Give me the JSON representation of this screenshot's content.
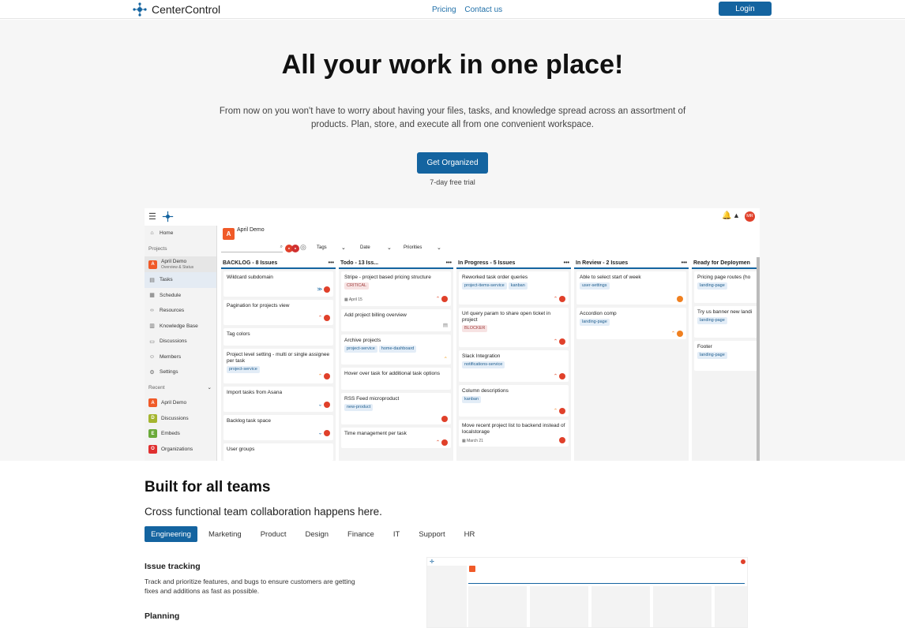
{
  "nav": {
    "brand": "CenterControl",
    "links": [
      "Pricing",
      "Contact us"
    ],
    "login": "Login"
  },
  "hero": {
    "title": "All your work in one place!",
    "subtitle": "From now on you won't have to worry about having your files, tasks, and knowledge spread across an assortment of products. Plan, store, and execute all from one convenient workspace.",
    "cta": "Get Organized",
    "trial": "7-day free trial"
  },
  "app": {
    "project": "April Demo",
    "project_avatar": "A",
    "user_initials": "MR",
    "filters": [
      "Tags",
      "Date",
      "Priorities"
    ],
    "sidebar": {
      "home": "Home",
      "projects_label": "Projects",
      "project_name": "April Demo",
      "project_sub": "Overview & Status",
      "items": [
        "Tasks",
        "Schedule",
        "Resources",
        "Knowledge Base",
        "Discussions",
        "Members",
        "Settings"
      ],
      "recent_label": "Recent",
      "recent": [
        {
          "letter": "A",
          "name": "April Demo",
          "color": "#f05a28"
        },
        {
          "letter": "D",
          "name": "Discussions",
          "color": "#a5b52f"
        },
        {
          "letter": "E",
          "name": "Embeds",
          "color": "#6aaa3a"
        },
        {
          "letter": "O",
          "name": "Organizations",
          "color": "#e03030"
        }
      ]
    },
    "columns": [
      {
        "title": "BACKLOG - 8 Issues",
        "cards": [
          {
            "title": "Wildcard subdomain",
            "tags": []
          },
          {
            "title": "Pagination for projects view",
            "tags": []
          },
          {
            "title": "Tag colors",
            "tags": []
          },
          {
            "title": "Project level setting - multi or single assignee per task",
            "tags": [
              "project-service"
            ]
          },
          {
            "title": "Import tasks from Asana",
            "tags": []
          },
          {
            "title": "Backlog task space",
            "tags": []
          },
          {
            "title": "User groups",
            "tags": []
          }
        ]
      },
      {
        "title": "Todo - 13 Iss...",
        "cards": [
          {
            "title": "Stripe - project based pricing structure",
            "tags": [
              "CRITICAL"
            ],
            "date": "April 15"
          },
          {
            "title": "Add project billing overview",
            "tags": []
          },
          {
            "title": "Archive projects",
            "tags": [
              "project-service",
              "home-dashboard"
            ]
          },
          {
            "title": "Hover over task for additional task options",
            "tags": []
          },
          {
            "title": "RSS Feed microproduct",
            "tags": [
              "new-product"
            ]
          },
          {
            "title": "Time management per task",
            "tags": []
          }
        ]
      },
      {
        "title": "In Progress - 5 Issues",
        "cards": [
          {
            "title": "Reworked task order queries",
            "tags": [
              "project-items-service",
              "kanban"
            ]
          },
          {
            "title": "Url query param to share open ticket in project",
            "tags": [
              "BLOCKER"
            ]
          },
          {
            "title": "Slack Integration",
            "tags": [
              "notifications-service"
            ]
          },
          {
            "title": "Column descriptions",
            "tags": [
              "kanban"
            ]
          },
          {
            "title": "Move recent project list to backend instead of localstorage",
            "tags": [],
            "date": "March 21"
          }
        ]
      },
      {
        "title": "In Review - 2 Issues",
        "cards": [
          {
            "title": "Able to select start of week",
            "tags": [
              "user-settings"
            ]
          },
          {
            "title": "Accordion comp",
            "tags": [
              "landing-page"
            ]
          }
        ]
      },
      {
        "title": "Ready for Deploymen",
        "cards": [
          {
            "title": "Pricing page routes (ho",
            "tags": [
              "landing-page"
            ]
          },
          {
            "title": "Try us banner new landi",
            "tags": [
              "landing-page"
            ]
          },
          {
            "title": "Footer",
            "tags": [
              "landing-page"
            ]
          }
        ]
      }
    ]
  },
  "teams": {
    "title": "Built for all teams",
    "subtitle": "Cross functional team collaboration happens here.",
    "tabs": [
      "Engineering",
      "Marketing",
      "Product",
      "Design",
      "Finance",
      "IT",
      "Support",
      "HR"
    ],
    "active_tab": "Engineering",
    "features": [
      {
        "title": "Issue tracking",
        "desc": "Track and prioritize features, and bugs to ensure customers are getting fixes and additions as fast as possible."
      },
      {
        "title": "Planning",
        "desc": ""
      }
    ]
  },
  "colors": {
    "primary": "#1464a0",
    "accent": "#f05a28",
    "background": "#f6f6f6"
  }
}
